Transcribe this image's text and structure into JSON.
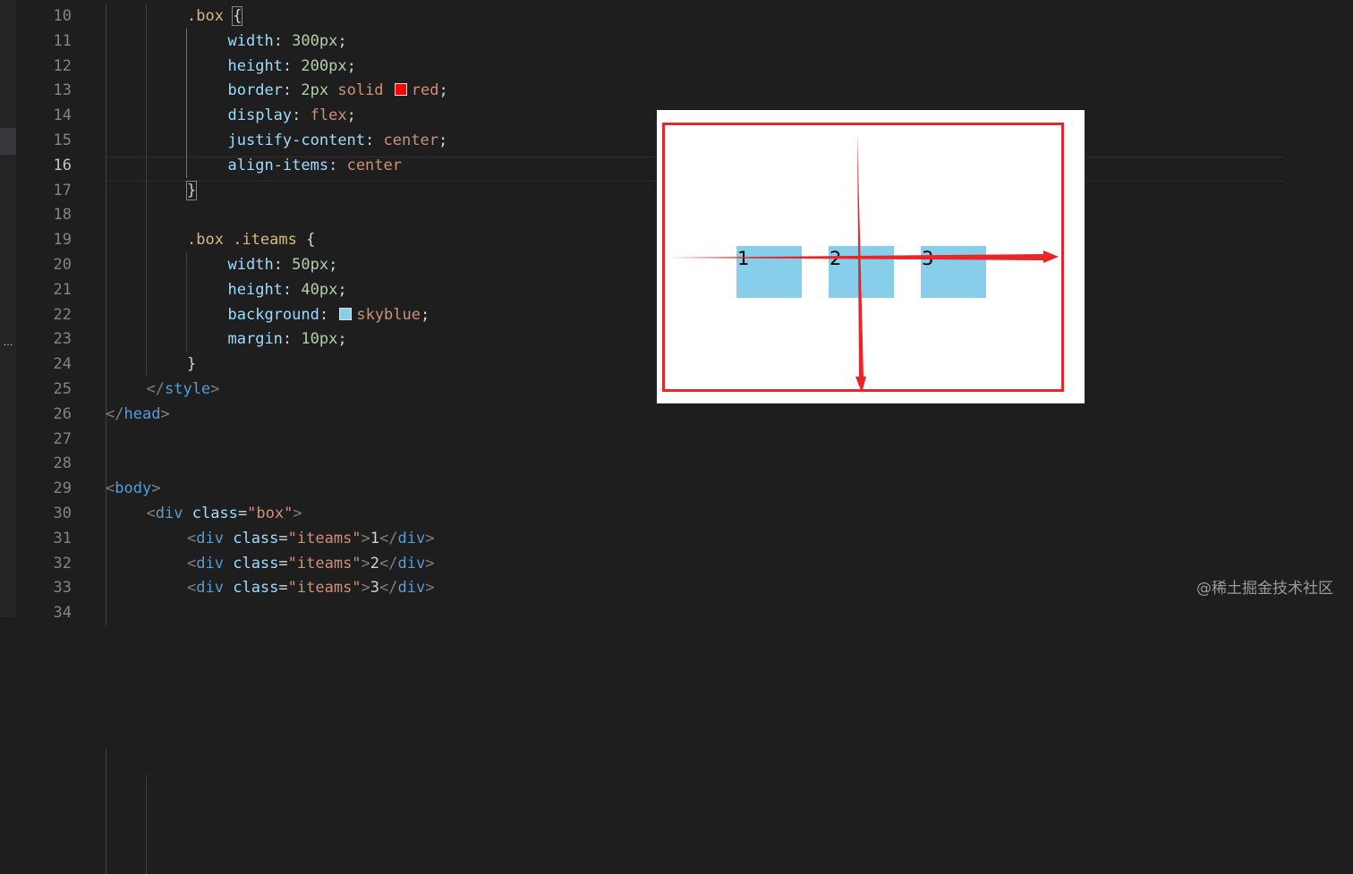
{
  "editor": {
    "lines": [
      {
        "n": "10",
        "active": false,
        "indent": 2,
        "tokens": [
          {
            "t": ".box",
            "c": "tk-sel"
          },
          {
            "t": " ",
            "c": "tk-punct"
          },
          {
            "t": "{",
            "c": "tk-punct",
            "hl": true
          }
        ]
      },
      {
        "n": "11",
        "active": false,
        "indent": 3,
        "tokens": [
          {
            "t": "width",
            "c": "tk-prop"
          },
          {
            "t": ": ",
            "c": "tk-punct"
          },
          {
            "t": "300px",
            "c": "tk-num"
          },
          {
            "t": ";",
            "c": "tk-punct"
          }
        ]
      },
      {
        "n": "12",
        "active": false,
        "indent": 3,
        "tokens": [
          {
            "t": "height",
            "c": "tk-prop"
          },
          {
            "t": ": ",
            "c": "tk-punct"
          },
          {
            "t": "200px",
            "c": "tk-num"
          },
          {
            "t": ";",
            "c": "tk-punct"
          }
        ]
      },
      {
        "n": "13",
        "active": false,
        "indent": 3,
        "tokens": [
          {
            "t": "border",
            "c": "tk-prop"
          },
          {
            "t": ": ",
            "c": "tk-punct"
          },
          {
            "t": "2px",
            "c": "tk-num"
          },
          {
            "t": " solid ",
            "c": "tk-val"
          },
          {
            "swatch": "#ff0000"
          },
          {
            "t": "red",
            "c": "tk-val"
          },
          {
            "t": ";",
            "c": "tk-punct"
          }
        ]
      },
      {
        "n": "14",
        "active": false,
        "indent": 3,
        "tokens": [
          {
            "t": "display",
            "c": "tk-prop"
          },
          {
            "t": ": ",
            "c": "tk-punct"
          },
          {
            "t": "flex",
            "c": "tk-val"
          },
          {
            "t": ";",
            "c": "tk-punct"
          }
        ]
      },
      {
        "n": "15",
        "active": false,
        "indent": 3,
        "tokens": [
          {
            "t": "justify-content",
            "c": "tk-prop"
          },
          {
            "t": ": ",
            "c": "tk-punct"
          },
          {
            "t": "center",
            "c": "tk-val"
          },
          {
            "t": ";",
            "c": "tk-punct"
          }
        ]
      },
      {
        "n": "16",
        "active": true,
        "indent": 3,
        "tokens": [
          {
            "t": "align-items",
            "c": "tk-prop"
          },
          {
            "t": ": ",
            "c": "tk-punct"
          },
          {
            "t": "center",
            "c": "tk-val"
          }
        ]
      },
      {
        "n": "17",
        "active": false,
        "indent": 2,
        "tokens": [
          {
            "t": "}",
            "c": "tk-punct",
            "hl": true
          }
        ]
      },
      {
        "n": "18",
        "active": false,
        "indent": 0,
        "tokens": []
      },
      {
        "n": "19",
        "active": false,
        "indent": 2,
        "tokens": [
          {
            "t": ".box",
            "c": "tk-sel"
          },
          {
            "t": " ",
            "c": "tk-punct"
          },
          {
            "t": ".iteams",
            "c": "tk-sel"
          },
          {
            "t": " {",
            "c": "tk-punct"
          }
        ]
      },
      {
        "n": "20",
        "active": false,
        "indent": 3,
        "tokens": [
          {
            "t": "width",
            "c": "tk-prop"
          },
          {
            "t": ": ",
            "c": "tk-punct"
          },
          {
            "t": "50px",
            "c": "tk-num"
          },
          {
            "t": ";",
            "c": "tk-punct"
          }
        ]
      },
      {
        "n": "21",
        "active": false,
        "indent": 3,
        "tokens": [
          {
            "t": "height",
            "c": "tk-prop"
          },
          {
            "t": ": ",
            "c": "tk-punct"
          },
          {
            "t": "40px",
            "c": "tk-num"
          },
          {
            "t": ";",
            "c": "tk-punct"
          }
        ]
      },
      {
        "n": "22",
        "active": false,
        "indent": 3,
        "tokens": [
          {
            "t": "background",
            "c": "tk-prop"
          },
          {
            "t": ": ",
            "c": "tk-punct"
          },
          {
            "swatch": "#87ceeb"
          },
          {
            "t": "skyblue",
            "c": "tk-val"
          },
          {
            "t": ";",
            "c": "tk-punct"
          }
        ]
      },
      {
        "n": "23",
        "active": false,
        "indent": 3,
        "tokens": [
          {
            "t": "margin",
            "c": "tk-prop"
          },
          {
            "t": ": ",
            "c": "tk-punct"
          },
          {
            "t": "10px",
            "c": "tk-num"
          },
          {
            "t": ";",
            "c": "tk-punct"
          }
        ]
      },
      {
        "n": "24",
        "active": false,
        "indent": 2,
        "tokens": [
          {
            "t": "}",
            "c": "tk-punct"
          }
        ]
      },
      {
        "n": "25",
        "active": false,
        "indent": 1,
        "tokens": [
          {
            "t": "</",
            "c": "tk-bracket"
          },
          {
            "t": "style",
            "c": "tk-tag"
          },
          {
            "t": ">",
            "c": "tk-bracket"
          }
        ]
      },
      {
        "n": "26",
        "active": false,
        "indent": 0,
        "tokens": [
          {
            "t": "</",
            "c": "tk-bracket"
          },
          {
            "t": "head",
            "c": "tk-tag"
          },
          {
            "t": ">",
            "c": "tk-bracket"
          }
        ]
      },
      {
        "n": "27",
        "active": false,
        "indent": 0,
        "tokens": []
      },
      {
        "n": "28",
        "active": false,
        "indent": 0,
        "tokens": []
      },
      {
        "n": "29",
        "active": false,
        "indent": 0,
        "tokens": [
          {
            "t": "<",
            "c": "tk-bracket"
          },
          {
            "t": "body",
            "c": "tk-tag"
          },
          {
            "t": ">",
            "c": "tk-bracket"
          }
        ]
      },
      {
        "n": "30",
        "active": false,
        "indent": 1,
        "tokens": [
          {
            "t": "<",
            "c": "tk-bracket"
          },
          {
            "t": "div",
            "c": "tk-tag"
          },
          {
            "t": " ",
            "c": "tk-text"
          },
          {
            "t": "class",
            "c": "tk-attr"
          },
          {
            "t": "=",
            "c": "tk-text"
          },
          {
            "t": "\"box\"",
            "c": "tk-str"
          },
          {
            "t": ">",
            "c": "tk-bracket"
          }
        ]
      },
      {
        "n": "31",
        "active": false,
        "indent": 2,
        "tokens": [
          {
            "t": "<",
            "c": "tk-bracket"
          },
          {
            "t": "div",
            "c": "tk-tag"
          },
          {
            "t": " ",
            "c": "tk-text"
          },
          {
            "t": "class",
            "c": "tk-attr"
          },
          {
            "t": "=",
            "c": "tk-text"
          },
          {
            "t": "\"iteams\"",
            "c": "tk-str"
          },
          {
            "t": ">",
            "c": "tk-bracket"
          },
          {
            "t": "1",
            "c": "tk-text"
          },
          {
            "t": "</",
            "c": "tk-bracket"
          },
          {
            "t": "div",
            "c": "tk-tag"
          },
          {
            "t": ">",
            "c": "tk-bracket"
          }
        ]
      },
      {
        "n": "32",
        "active": false,
        "indent": 2,
        "tokens": [
          {
            "t": "<",
            "c": "tk-bracket"
          },
          {
            "t": "div",
            "c": "tk-tag"
          },
          {
            "t": " ",
            "c": "tk-text"
          },
          {
            "t": "class",
            "c": "tk-attr"
          },
          {
            "t": "=",
            "c": "tk-text"
          },
          {
            "t": "\"iteams\"",
            "c": "tk-str"
          },
          {
            "t": ">",
            "c": "tk-bracket"
          },
          {
            "t": "2",
            "c": "tk-text"
          },
          {
            "t": "</",
            "c": "tk-bracket"
          },
          {
            "t": "div",
            "c": "tk-tag"
          },
          {
            "t": ">",
            "c": "tk-bracket"
          }
        ]
      },
      {
        "n": "33",
        "active": false,
        "indent": 2,
        "tokens": [
          {
            "t": "<",
            "c": "tk-bracket"
          },
          {
            "t": "div",
            "c": "tk-tag"
          },
          {
            "t": " ",
            "c": "tk-text"
          },
          {
            "t": "class",
            "c": "tk-attr"
          },
          {
            "t": "=",
            "c": "tk-text"
          },
          {
            "t": "\"iteams\"",
            "c": "tk-str"
          },
          {
            "t": ">",
            "c": "tk-bracket"
          },
          {
            "t": "3",
            "c": "tk-text"
          },
          {
            "t": "</",
            "c": "tk-bracket"
          },
          {
            "t": "div",
            "c": "tk-tag"
          },
          {
            "t": ">",
            "c": "tk-bracket"
          }
        ]
      },
      {
        "n": "34",
        "active": false,
        "indent": 0,
        "tokens": []
      }
    ]
  },
  "sidebar": {
    "overflow_label": "..."
  },
  "preview": {
    "box_border_color": "#e8262a",
    "item_color": "#87ceeb",
    "arrow_color": "#e8262a",
    "items": [
      "1",
      "2",
      "3"
    ]
  },
  "watermark": {
    "text": "@稀土掘金技术社区"
  }
}
